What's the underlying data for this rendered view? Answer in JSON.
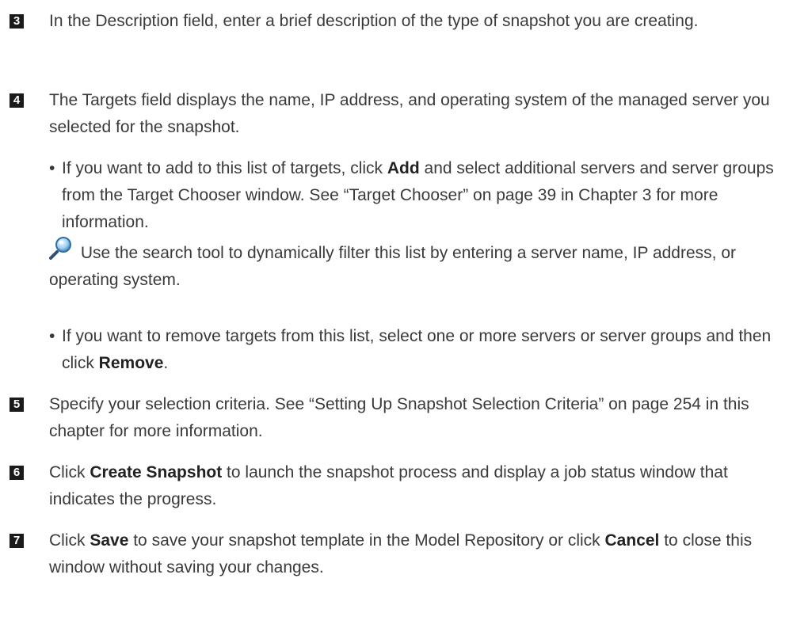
{
  "steps": [
    {
      "number": "3",
      "text": "In the Description field, enter a brief description of the type of snapshot you are creating."
    },
    {
      "number": "4",
      "text": "The Targets field displays the name, IP address, and operating system of the managed server you selected for the snapshot."
    },
    {
      "number": "5",
      "text": "Specify your selection criteria. See “Setting Up Snapshot Selection Criteria” on page 254 in this chapter for more information."
    },
    {
      "number": "6",
      "pre": "Click ",
      "bold": "Create Snapshot",
      "post": " to launch the snapshot process and display a job status window that indicates the progress."
    },
    {
      "number": "7",
      "pre": "Click ",
      "bold": "Save",
      "mid": " to save your snapshot template in the Model Repository or click ",
      "bold2": "Cancel",
      "post": " to close this window without saving your changes."
    }
  ],
  "bullets": [
    {
      "dot": "•",
      "pre": "If you want to add to this list of targets, click ",
      "bold": "Add",
      "post": " and select additional servers and server groups from the Target Chooser window. See “Target Chooser” on page 39 in Chapter 3 for more information."
    },
    {
      "dot": "•",
      "pre": "If you want to remove targets from this list, select one or more servers or server groups and then click ",
      "bold": "Remove",
      "post": "."
    }
  ],
  "tip": {
    "icon": "magnifier-icon",
    "text": "Use the search tool to dynamically filter this list by entering a server name, IP address, or operating system."
  }
}
